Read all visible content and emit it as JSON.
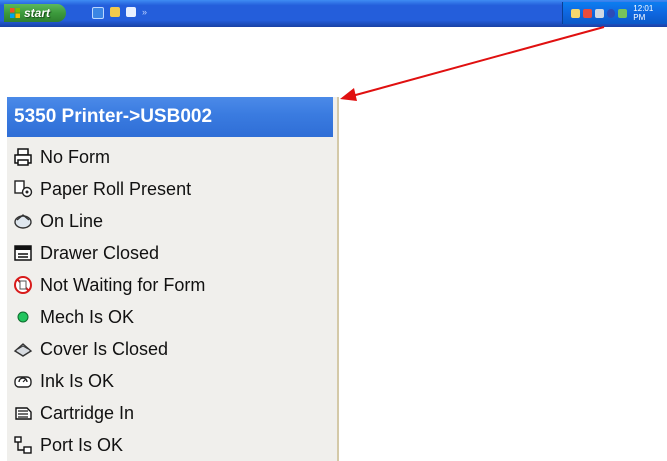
{
  "taskbar": {
    "start_label": "start",
    "clock": "12:01 PM"
  },
  "status_menu": {
    "title": "5350 Printer->USB002",
    "items": [
      {
        "label": "No Form",
        "icon": "printer-icon"
      },
      {
        "label": "Paper Roll Present",
        "icon": "paper-roll-icon"
      },
      {
        "label": "On Line",
        "icon": "online-icon"
      },
      {
        "label": "Drawer Closed",
        "icon": "drawer-icon"
      },
      {
        "label": "Not Waiting for Form",
        "icon": "not-waiting-icon"
      },
      {
        "label": "Mech Is OK",
        "icon": "green-dot-icon"
      },
      {
        "label": "Cover Is Closed",
        "icon": "cover-icon"
      },
      {
        "label": "Ink Is OK",
        "icon": "ink-icon"
      },
      {
        "label": "Cartridge In",
        "icon": "cartridge-icon"
      },
      {
        "label": "Port Is OK",
        "icon": "port-icon"
      }
    ]
  },
  "colors": {
    "taskbar": "#245edb",
    "start": "#3c9a3c",
    "title_bar": "#3a7be0",
    "menu_bg": "#f0efec",
    "arrow": "#e01010",
    "status_ok": "#22c55e"
  }
}
